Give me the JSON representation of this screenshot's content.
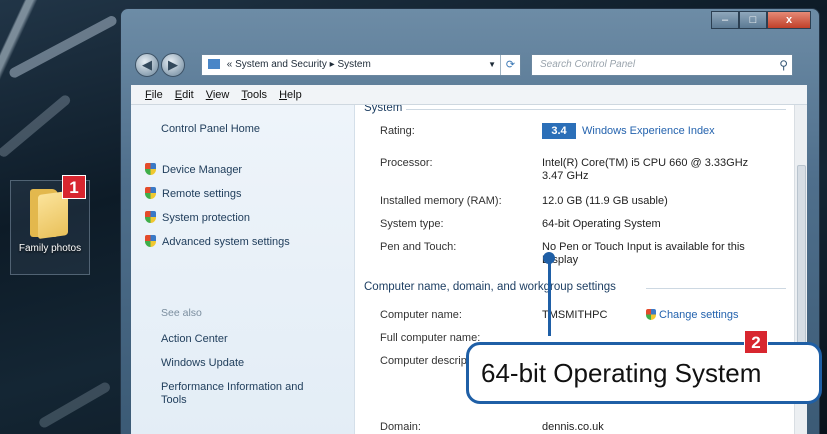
{
  "desktop": {
    "icon_label": "Family photos",
    "badge": "1"
  },
  "window": {
    "caption": {
      "minimize": "–",
      "maximize": "□",
      "close": "x"
    },
    "nav": {
      "back": "◀",
      "forward": "▶"
    },
    "address": {
      "prefix": "«",
      "path": [
        "System and Security",
        "System"
      ],
      "separator": "▸"
    },
    "search": {
      "placeholder": "Search Control Panel"
    },
    "menu": [
      "File",
      "Edit",
      "View",
      "Tools",
      "Help"
    ],
    "left_pane": {
      "home": "Control Panel Home",
      "tasks": [
        "Device Manager",
        "Remote settings",
        "System protection",
        "Advanced system settings"
      ],
      "see_also_title": "See also",
      "see_also": [
        "Action Center",
        "Windows Update",
        "Performance Information and Tools"
      ]
    },
    "system": {
      "title": "System",
      "rating_label": "Rating:",
      "rating_badge": "3.4",
      "rating_value": "Windows Experience Index",
      "processor_label": "Processor:",
      "processor_value": "Intel(R) Core(TM) i5 CPU 660 @ 3.33GHz 3.47 GHz",
      "memory_label": "Installed memory (RAM):",
      "memory_value": "12.0 GB (11.9 GB usable)",
      "type_label": "System type:",
      "type_value": "64-bit Operating System",
      "pen_label": "Pen and Touch:",
      "pen_value": "No Pen or Touch Input is available for this Display"
    },
    "computer": {
      "title": "Computer name, domain, and workgroup settings",
      "name_label": "Computer name:",
      "name_value": "TMSMITHPC",
      "change_link": "Change settings",
      "full_label": "Full computer name:",
      "desc_label": "Computer description:",
      "domain_label": "Domain:",
      "domain_value": "dennis.co.uk"
    }
  },
  "callout": {
    "badge": "2",
    "text": "64-bit Operating System"
  }
}
